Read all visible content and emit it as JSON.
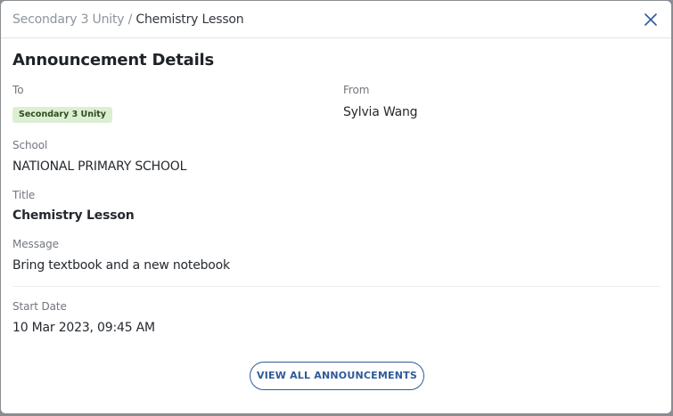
{
  "breadcrumb": {
    "parent": "Secondary 3 Unity",
    "separator": "/",
    "current": "Chemistry Lesson"
  },
  "close_icon": "close-icon",
  "heading": "Announcement Details",
  "fields": {
    "to_label": "To",
    "to_tag": "Secondary 3 Unity",
    "from_label": "From",
    "from_value": "Sylvia Wang",
    "school_label": "School",
    "school_value": "NATIONAL PRIMARY SCHOOL",
    "title_label": "Title",
    "title_value": "Chemistry Lesson",
    "message_label": "Message",
    "message_value": "Bring textbook and a new notebook",
    "start_date_label": "Start Date",
    "start_date_value": "10 Mar 2023, 09:45 AM"
  },
  "actions": {
    "view_all_label": "VIEW ALL ANNOUNCEMENTS"
  },
  "colors": {
    "accent": "#2f5a99",
    "tag_background": "#dcefd2",
    "tag_text": "#2f4a1e",
    "backdrop": "#8a8d91"
  }
}
